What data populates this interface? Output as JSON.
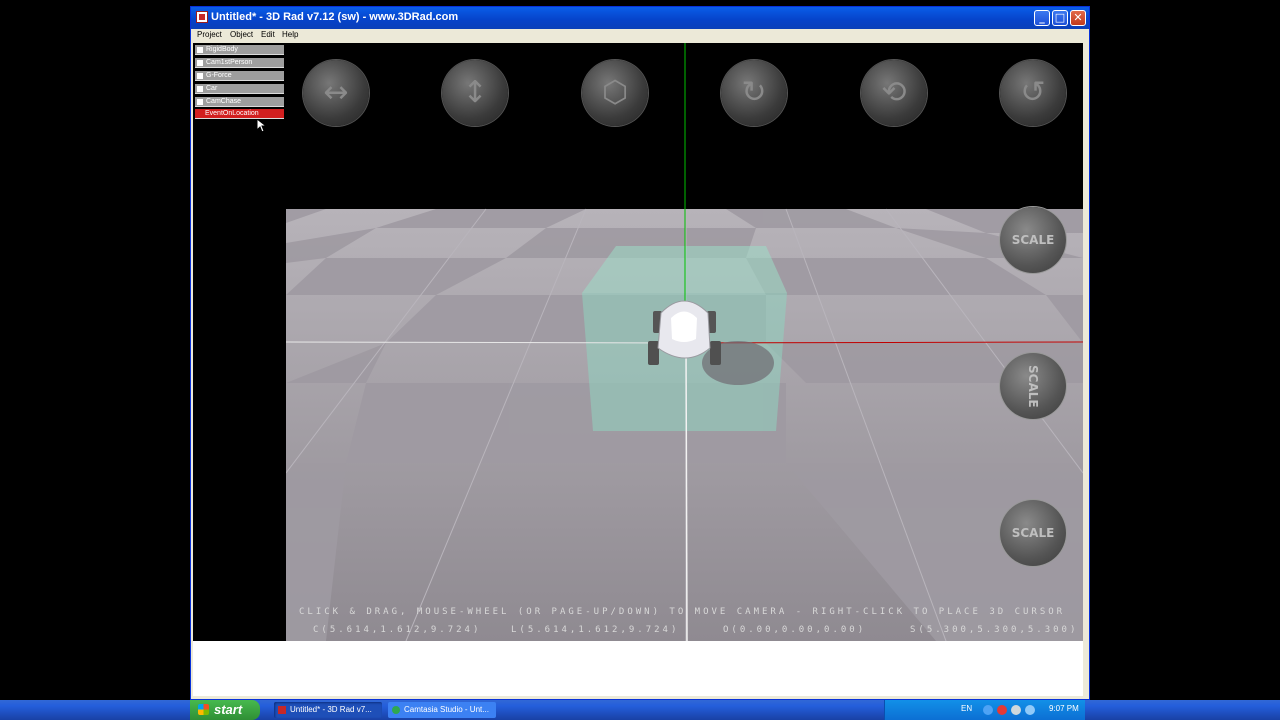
{
  "window": {
    "title": "Untitled* - 3D Rad v7.12 (sw) - www.3DRad.com",
    "controls": {
      "minimize": "_",
      "maximize": "□",
      "close": "✕"
    }
  },
  "menu": [
    "Project",
    "Object",
    "Edit",
    "Help"
  ],
  "objects": [
    {
      "label": "RigidBody",
      "selected": false
    },
    {
      "label": "Cam1stPerson",
      "selected": false
    },
    {
      "label": "G-Force",
      "selected": false
    },
    {
      "label": "Car",
      "selected": false
    },
    {
      "label": "CamChase",
      "selected": false
    },
    {
      "label": "EventOnLocation",
      "selected": true
    }
  ],
  "nav_icons": [
    "move-horizontal-icon",
    "move-vertical-icon",
    "move-depth-icon",
    "rotate-y-icon",
    "rotate-x-icon",
    "rotate-z-icon"
  ],
  "scale_buttons": [
    {
      "label": "SCALE",
      "icon": "scale-horizontal-icon"
    },
    {
      "label": "SCALE",
      "icon": "scale-vertical-icon"
    },
    {
      "label": "SCALE",
      "icon": "scale-depth-icon"
    }
  ],
  "hud": {
    "help": "CLICK & DRAG, MOUSE-WHEEL (OR PAGE-UP/DOWN) TO MOVE CAMERA - RIGHT-CLICK TO PLACE 3D CURSOR",
    "camera": "C(5.614,1.612,9.724)",
    "look": "L(5.614,1.612,9.724)",
    "origin": "O(0.00,0.00,0.00)",
    "scale": "S(5.300,5.300,5.300)"
  },
  "taskbar": {
    "start": "start",
    "tasks": [
      {
        "label": "Untitled* - 3D Rad v7...",
        "active": true
      },
      {
        "label": "Camtasia Studio - Unt...",
        "active": false
      }
    ],
    "lang": "EN",
    "clock": "9:07 PM"
  },
  "colors": {
    "selected_item": "#d21f1f",
    "trigger_box": "#8fd3bf",
    "axis_y": "#00c000",
    "axis_x": "#c00000"
  }
}
